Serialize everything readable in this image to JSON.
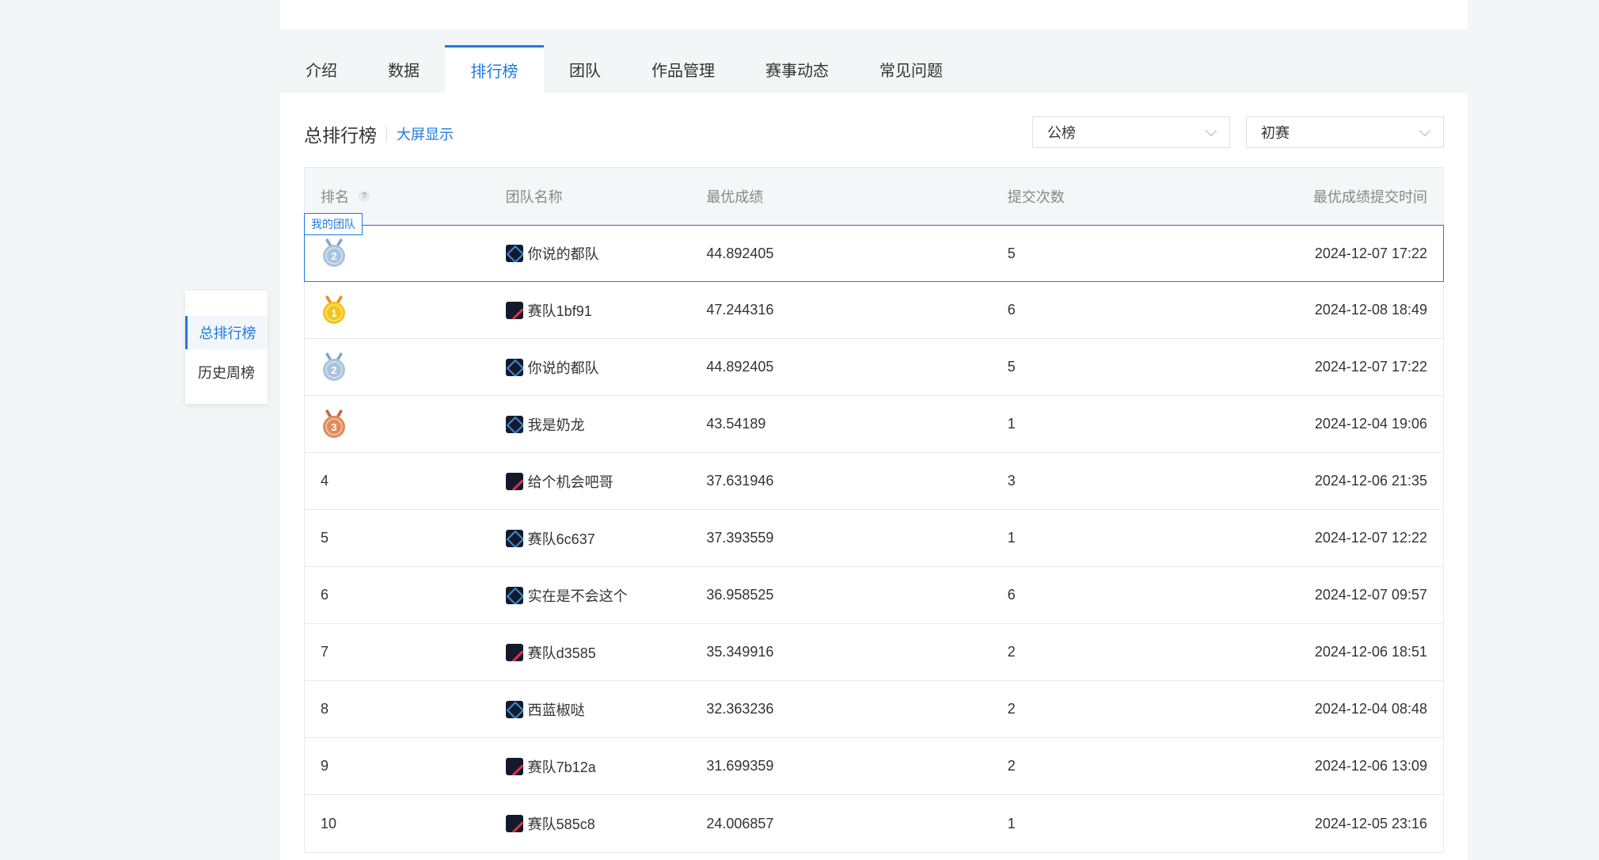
{
  "tabs": [
    "介绍",
    "数据",
    "排行榜",
    "团队",
    "作品管理",
    "赛事动态",
    "常见问题"
  ],
  "active_tab": "排行榜",
  "title": "总排行榜",
  "bigscreen_link": "大屏显示",
  "filters": {
    "board": "公榜",
    "stage": "初赛"
  },
  "columns": {
    "rank": "排名",
    "help": "?",
    "team": "团队名称",
    "score": "最优成绩",
    "submissions": "提交次数",
    "time": "最优成绩提交时间"
  },
  "my_team_badge": "我的团队",
  "my_row": {
    "rank": "2",
    "team": "你说的都队",
    "score": "44.892405",
    "submissions": "5",
    "time": "2024-12-07 17:22"
  },
  "rows": [
    {
      "rank": "1",
      "team": "赛队1bf91",
      "score": "47.244316",
      "submissions": "6",
      "time": "2024-12-08 18:49"
    },
    {
      "rank": "2",
      "team": "你说的都队",
      "score": "44.892405",
      "submissions": "5",
      "time": "2024-12-07 17:22"
    },
    {
      "rank": "3",
      "team": "我是奶龙",
      "score": "43.54189",
      "submissions": "1",
      "time": "2024-12-04 19:06"
    },
    {
      "rank": "4",
      "team": "给个机会吧哥",
      "score": "37.631946",
      "submissions": "3",
      "time": "2024-12-06 21:35"
    },
    {
      "rank": "5",
      "team": "赛队6c637",
      "score": "37.393559",
      "submissions": "1",
      "time": "2024-12-07 12:22"
    },
    {
      "rank": "6",
      "team": "实在是不会这个",
      "score": "36.958525",
      "submissions": "6",
      "time": "2024-12-07 09:57"
    },
    {
      "rank": "7",
      "team": "赛队d3585",
      "score": "35.349916",
      "submissions": "2",
      "time": "2024-12-06 18:51"
    },
    {
      "rank": "8",
      "team": "西蓝椒哒",
      "score": "32.363236",
      "submissions": "2",
      "time": "2024-12-04 08:48"
    },
    {
      "rank": "9",
      "team": "赛队7b12a",
      "score": "31.699359",
      "submissions": "2",
      "time": "2024-12-06 13:09"
    },
    {
      "rank": "10",
      "team": "赛队585c8",
      "score": "24.006857",
      "submissions": "1",
      "time": "2024-12-05 23:16"
    }
  ],
  "side_menu": [
    "总排行榜",
    "历史周榜"
  ],
  "colors": {
    "accent": "#1f7ae0",
    "gold": "#f5c518",
    "silver": "#a9c4dc",
    "bronze": "#e08c5a"
  }
}
